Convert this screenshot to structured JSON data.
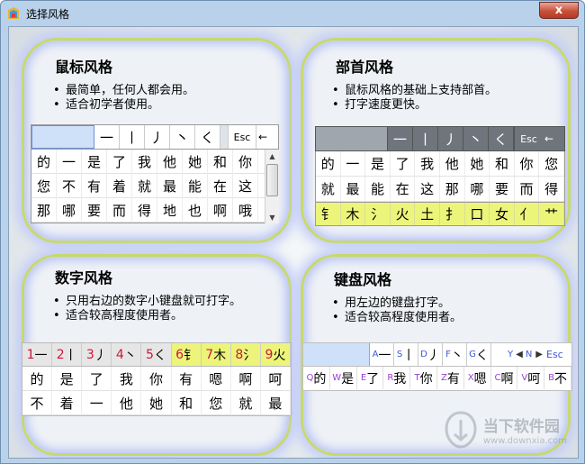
{
  "window": {
    "title": "选择风格",
    "close_label": "x"
  },
  "cards": {
    "mouse": {
      "title": "鼠标风格",
      "bullets": [
        "最简单，任何人都会用。",
        "适合初学者使用。"
      ],
      "strokes": [
        "一",
        "丨",
        "丿",
        "丶",
        "く"
      ],
      "esc_label": "Esc",
      "arrow_label": "←",
      "rows": [
        [
          "的",
          "一",
          "是",
          "了",
          "我",
          "他",
          "她",
          "和",
          "你"
        ],
        [
          "您",
          "不",
          "有",
          "着",
          "就",
          "最",
          "能",
          "在",
          "这"
        ],
        [
          "那",
          "哪",
          "要",
          "而",
          "得",
          "地",
          "也",
          "啊",
          "哦"
        ]
      ]
    },
    "radical": {
      "title": "部首风格",
      "bullets": [
        "鼠标风格的基础上支持部首。",
        "打字速度更快。"
      ],
      "strokes": [
        "一",
        "丨",
        "丿",
        "丶",
        "く"
      ],
      "esc_label": "Esc",
      "arrow_label": "←",
      "rows": [
        [
          "的",
          "一",
          "是",
          "了",
          "我",
          "他",
          "她",
          "和",
          "你",
          "您"
        ],
        [
          "就",
          "最",
          "能",
          "在",
          "这",
          "那",
          "哪",
          "要",
          "而",
          "得"
        ]
      ],
      "radicals": [
        "钅",
        "木",
        "氵",
        "火",
        "土",
        "扌",
        "口",
        "女",
        "亻",
        "艹"
      ]
    },
    "number": {
      "title": "数字风格",
      "bullets": [
        "只用右边的数字小键盘就可打字。",
        "适合较高程度使用者。"
      ],
      "keys": [
        {
          "n": "1",
          "c": "一"
        },
        {
          "n": "2",
          "c": "丨"
        },
        {
          "n": "3",
          "c": "丿"
        },
        {
          "n": "4",
          "c": "丶"
        },
        {
          "n": "5",
          "c": "く"
        },
        {
          "n": "6",
          "c": "钅"
        },
        {
          "n": "7",
          "c": "木"
        },
        {
          "n": "8",
          "c": "氵"
        },
        {
          "n": "9",
          "c": "火"
        }
      ],
      "rows": [
        [
          "的",
          "是",
          "了",
          "我",
          "你",
          "有",
          "嗯",
          "啊",
          "呵"
        ],
        [
          "不",
          "着",
          "一",
          "他",
          "她",
          "和",
          "您",
          "就",
          "最"
        ]
      ]
    },
    "keyboard": {
      "title": "键盘风格",
      "bullets": [
        "用左边的键盘打字。",
        "适合较高程度使用者。"
      ],
      "keys": [
        {
          "k": "A",
          "c": "一"
        },
        {
          "k": "S",
          "c": "丨"
        },
        {
          "k": "D",
          "c": "丿"
        },
        {
          "k": "F",
          "c": "丶"
        },
        {
          "k": "G",
          "c": "く"
        }
      ],
      "nav": {
        "y": "Y",
        "n": "N",
        "esc": "Esc"
      },
      "cands": [
        {
          "k": "Q",
          "c": "的"
        },
        {
          "k": "W",
          "c": "是"
        },
        {
          "k": "E",
          "c": "了"
        },
        {
          "k": "R",
          "c": "我"
        },
        {
          "k": "T",
          "c": "你"
        },
        {
          "k": "Z",
          "c": "有"
        },
        {
          "k": "X",
          "c": "嗯"
        },
        {
          "k": "C",
          "c": "啊"
        },
        {
          "k": "V",
          "c": "呵"
        },
        {
          "k": "B",
          "c": "不"
        }
      ]
    }
  },
  "watermark": {
    "name": "当下软件园",
    "url": "www.downxia.com"
  },
  "colors": {
    "frame": "#b9d1ea",
    "card_border": "#c8d96a",
    "radical_bg": "#ecf57a",
    "key_num": "#d0143c",
    "key_letter": "#3d57d6",
    "key_bg": "#e6e6e6"
  }
}
